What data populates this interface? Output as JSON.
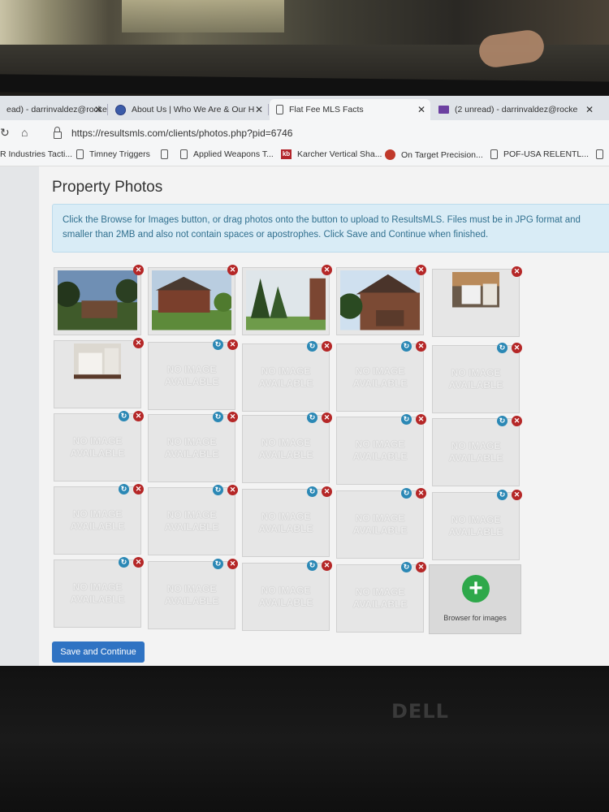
{
  "browser": {
    "tabs": [
      {
        "label": "ead) - darrinvaldez@rocke",
        "icon": "none"
      },
      {
        "label": "About Us | Who We Are & Our H",
        "icon": "globe"
      },
      {
        "label": "Flat Fee MLS Facts",
        "icon": "doc"
      },
      {
        "label": "(2 unread) - darrinvaldez@rocke",
        "icon": "mail"
      }
    ],
    "url": "https://resultsmls.com/clients/photos.php?pid=6746",
    "bookmarks": [
      {
        "label": "R Industries Tacti...",
        "icon": "none"
      },
      {
        "label": "Timney Triggers",
        "icon": "doc"
      },
      {
        "label": "Applied Weapons T...",
        "icon": "doc"
      },
      {
        "label": "Karcher Vertical Sha...",
        "icon": "kb"
      },
      {
        "label": "On Target Precision...",
        "icon": "red"
      },
      {
        "label": "POF-USA RELENTL...",
        "icon": "doc"
      }
    ]
  },
  "page": {
    "title": "Property Photos",
    "instructions": "Click the Browse for Images button, or drag photos onto the button to upload to ResultsMLS. Files must be in JPG format and smaller than 2MB and also not contain spaces or apostrophes. Click Save and Continue when finished.",
    "no_image_line1": "NO IMAGE",
    "no_image_line2": "AVAILABLE",
    "browse_label": "Browser for images",
    "save_label": "Save and Continue",
    "remove_glyph": "✕",
    "rotate_glyph": "↻",
    "plus_glyph": "+"
  },
  "photos": [
    {
      "slot": 1,
      "subject": "house-front-trees"
    },
    {
      "slot": 2,
      "subject": "house-side-yard"
    },
    {
      "slot": 3,
      "subject": "backyard-trees"
    },
    {
      "slot": 4,
      "subject": "house-garage"
    },
    {
      "slot": 5,
      "subject": "laundry-room"
    },
    {
      "slot": 6,
      "subject": "bathroom-vanity"
    }
  ],
  "empty_slots": 18,
  "logo_text": "DELL"
}
